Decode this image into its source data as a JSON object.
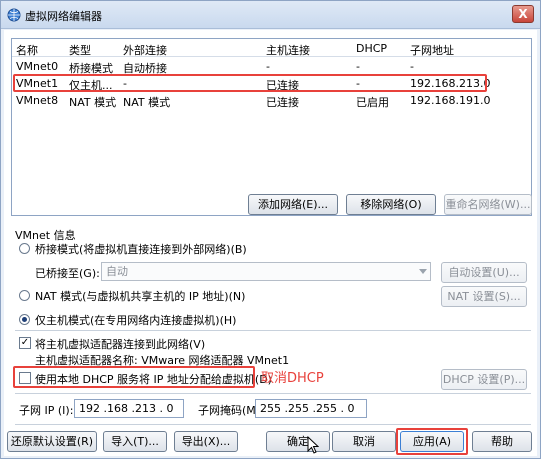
{
  "window": {
    "title": "虚拟网络编辑器",
    "close_label": "X"
  },
  "table": {
    "columns": [
      "名称",
      "类型",
      "外部连接",
      "主机连接",
      "DHCP",
      "子网地址"
    ],
    "rows": [
      [
        "VMnet0",
        "桥接模式",
        "自动桥接",
        "-",
        "-",
        "-"
      ],
      [
        "VMnet1",
        "仅主机...",
        "-",
        "已连接",
        "-",
        "192.168.213.0"
      ],
      [
        "VMnet8",
        "NAT 模式",
        "NAT 模式",
        "已连接",
        "已启用",
        "192.168.191.0"
      ]
    ]
  },
  "list_buttons": {
    "add": "添加网络(E)...",
    "remove": "移除网络(O)",
    "rename": "重命名网络(W)..."
  },
  "vmnet_info": {
    "label": "VMnet 信息",
    "bridge_mode": "桥接模式(将虚拟机直接连接到外部网络)(B)",
    "bridged_to_label": "已桥接至(G):",
    "bridged_to_value": "自动",
    "auto_settings": "自动设置(U)...",
    "nat_mode": "NAT 模式(与虚拟机共享主机的 IP 地址)(N)",
    "nat_settings": "NAT 设置(S)...",
    "host_only": "仅主机模式(在专用网络内连接虚拟机)(H)",
    "connect_adapter": "将主机虚拟适配器连接到此网络(V)",
    "adapter_name": "主机虚拟适配器名称: VMware 网络适配器 VMnet1",
    "use_dhcp": "使用本地 DHCP 服务将 IP 地址分配给虚拟机(D)",
    "dhcp_settings": "DHCP 设置(P)...",
    "subnet_ip_label": "子网 IP (I):",
    "subnet_ip_value": "192 .168 .213 . 0",
    "subnet_mask_label": "子网掩码(M):",
    "subnet_mask_value": "255 .255 .255 . 0"
  },
  "annotation": "取消DHCP",
  "footer": {
    "restore": "还原默认设置(R)",
    "import": "导入(T)...",
    "export": "导出(X)...",
    "ok": "确定",
    "cancel": "取消",
    "apply": "应用(A)",
    "help": "帮助"
  },
  "state": {
    "selected_mode": "host_only",
    "connect_adapter_checked": true,
    "use_dhcp_checked": false
  },
  "colors": {
    "highlight_red": "#e8413b",
    "border": "#8ea4c4"
  }
}
